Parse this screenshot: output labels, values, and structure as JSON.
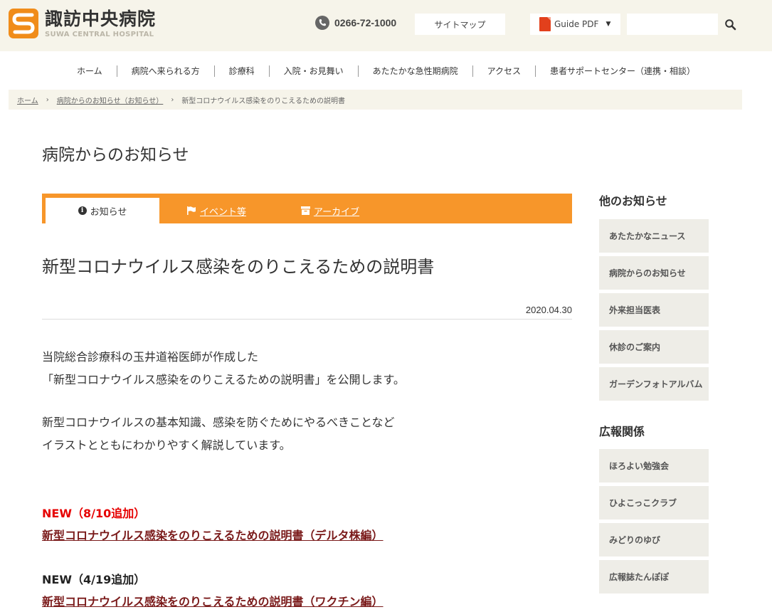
{
  "header": {
    "logo_ja": "諏訪中央病院",
    "logo_en": "SUWA CENTRAL HOSPITAL",
    "phone": "0266-72-1000",
    "sitemap_label": "サイトマップ",
    "guide_label": "Guide PDF",
    "search_placeholder": "",
    "icons": {
      "phone": "phone-icon",
      "pdf": "pdf-icon",
      "search": "search-icon"
    },
    "colors": {
      "background": "#f6f4ea",
      "logo": "#f08c1a"
    }
  },
  "nav": {
    "items": [
      "ホーム",
      "病院へ来られる方",
      "診療科",
      "入院・お見舞い",
      "あたたかな急性期病院",
      "アクセス",
      "患者サポートセンター（連携・相談）"
    ]
  },
  "breadcrumb": {
    "items": [
      "ホーム",
      "病院からのお知らせ（お知らせ）",
      "新型コロナウイルス感染をのりこえるための説明書"
    ],
    "separator": "›"
  },
  "page_title": "病院からのお知らせ",
  "tabs": {
    "items": [
      {
        "label": "お知らせ",
        "icon": "info-icon"
      },
      {
        "label": "イベント等",
        "icon": "flag-icon"
      },
      {
        "label": "アーカイブ",
        "icon": "archive-icon"
      }
    ],
    "accent_color": "#f7962a"
  },
  "article": {
    "title": "新型コロナウイルス感染をのりこえるための説明書",
    "date": "2020.04.30",
    "para1_line1": "当院総合診療科の玉井道裕医師が作成した",
    "para1_line2": "「新型コロナウイルス感染をのりこえるための説明書」を公開します。",
    "para2_line1": "新型コロナウイルスの基本知識、感染を防ぐためにやるべきことなど",
    "para2_line2": "イラストとともにわかりやすく解説しています。",
    "updates": [
      {
        "label": "NEW（8/10追加）",
        "link": "新型コロナウイルス感染をのりこえるための説明書（デルタ株編）",
        "label_color": "#e60000"
      },
      {
        "label": "NEW（4/19追加）",
        "link": "新型コロナウイルス感染をのりこえるための説明書（ワクチン編）",
        "label_color": "#222222"
      }
    ]
  },
  "sidebar": {
    "section1_title": "他のお知らせ",
    "section1_items": [
      "あたたかなニュース",
      "病院からのお知らせ",
      "外来担当医表",
      "休診のご案内",
      "ガーデンフォトアルバム"
    ],
    "section2_title": "広報関係",
    "section2_items": [
      "ほろよい勉強会",
      "ひよこっこクラブ",
      "みどりのゆび",
      "広報誌たんぽぽ"
    ]
  }
}
